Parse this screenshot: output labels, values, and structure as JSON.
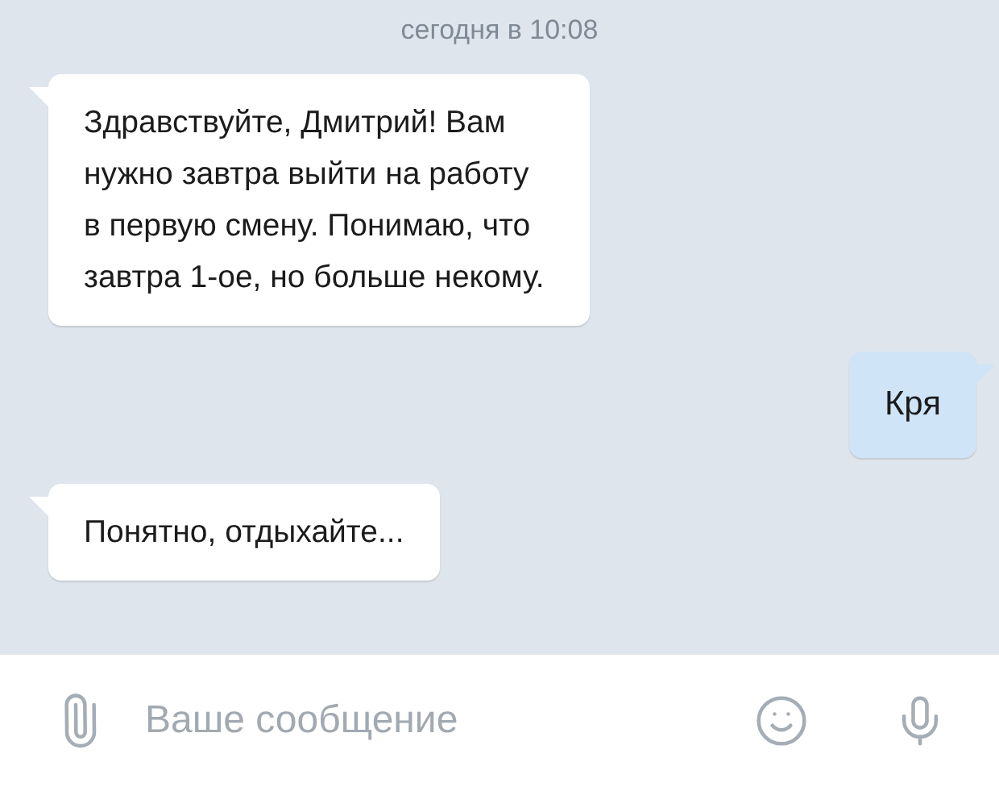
{
  "timestamp": "сегодня в 10:08",
  "messages": [
    {
      "kind": "incoming",
      "text": "Здравствуйте, Дмитрий! Вам нужно завтра выйти на работу в первую смену. Понимаю, что завтра 1-ое, но больше некому."
    },
    {
      "kind": "outgoing",
      "text": "Кря"
    },
    {
      "kind": "incoming",
      "text": "Понятно, отдыхайте..."
    }
  ],
  "composer": {
    "placeholder": "Ваше сообщение"
  }
}
